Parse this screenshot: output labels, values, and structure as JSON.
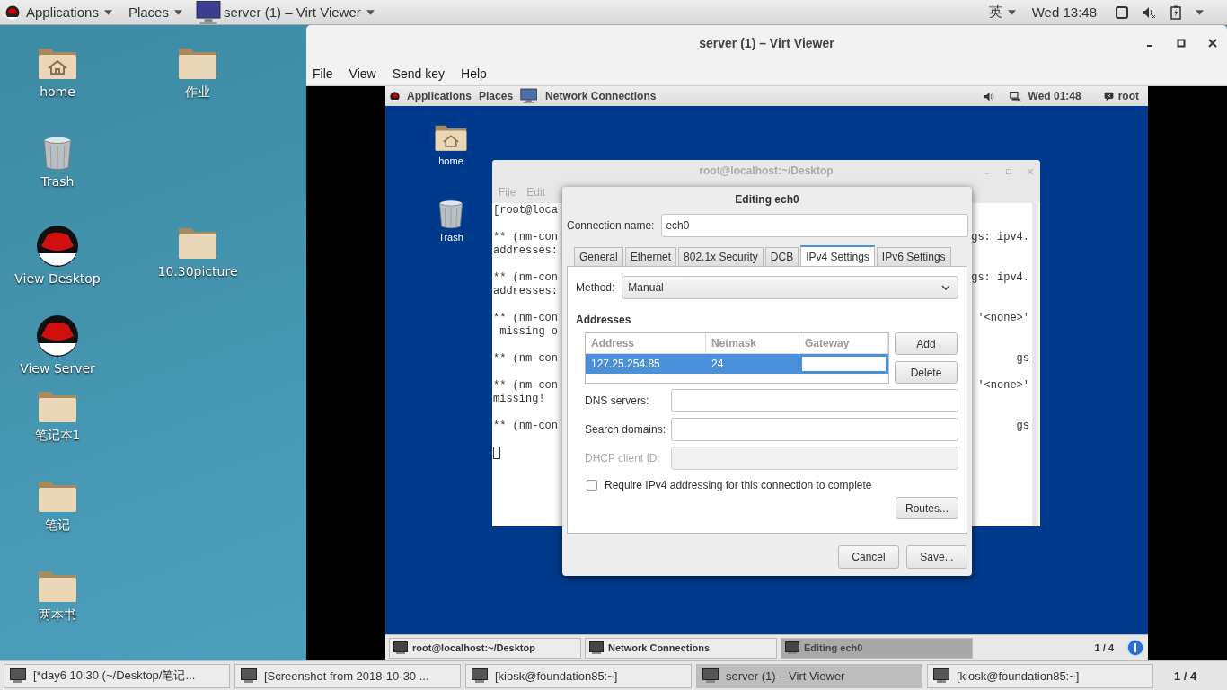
{
  "top_bar": {
    "menus": [
      "Applications",
      "Places"
    ],
    "window_menu": "server (1) – Virt Viewer",
    "input_method": "英",
    "clock": "Wed 13:48"
  },
  "desktop_icons": [
    {
      "kind": "home",
      "label": "home"
    },
    {
      "kind": "folder",
      "label": "作业"
    },
    {
      "kind": "trash",
      "label": "Trash"
    },
    {
      "kind": "hat",
      "label": "View Desktop"
    },
    {
      "kind": "folder",
      "label": "10.30picture"
    },
    {
      "kind": "hat",
      "label": "View Server"
    },
    {
      "kind": "folder",
      "label": "笔记本1"
    },
    {
      "kind": "folder",
      "label": "笔记"
    },
    {
      "kind": "folder",
      "label": "两本书"
    }
  ],
  "viewer_window": {
    "title": "server (1) – Virt Viewer",
    "menu": [
      "File",
      "View",
      "Send key",
      "Help"
    ],
    "guest": {
      "top_bar": {
        "menus": [
          "Applications",
          "Places"
        ],
        "window_menu": "Network Connections",
        "clock": "Wed 01:48",
        "user": "root"
      },
      "desktop_icons": [
        {
          "kind": "home",
          "label": "home"
        },
        {
          "kind": "trash",
          "label": "Trash"
        }
      ],
      "terminal": {
        "title": "root@localhost:~/Desktop",
        "menu": [
          "File",
          "Edit"
        ],
        "blocks": [
          [
            {
              "left": "[root@loca"
            }
          ],
          [
            {
              "left": "** (nm-con",
              "right": "gs: ipv4."
            },
            {
              "left": "addresses:"
            }
          ],
          [
            {
              "left": "** (nm-con",
              "right": "gs: ipv4."
            },
            {
              "left": "addresses:"
            }
          ],
          [
            {
              "left": "** (nm-con",
              "right": "'<none>'"
            },
            {
              "left": " missing o"
            }
          ],
          [
            {
              "left": "** (nm-con",
              "right": "gs"
            }
          ],
          [
            {
              "left": "** (nm-con",
              "right": "'<none>'"
            },
            {
              "left": "missing!"
            }
          ],
          [
            {
              "left": "** (nm-con",
              "right": "gs"
            }
          ]
        ]
      },
      "dialog": {
        "title": "Editing ech0",
        "connection_label": "Connection name:",
        "connection_name": "ech0",
        "tabs": [
          {
            "label": "General",
            "selected": false
          },
          {
            "label": "Ethernet",
            "selected": false
          },
          {
            "label": "802.1x Security",
            "selected": false
          },
          {
            "label": "DCB",
            "selected": false
          },
          {
            "label": "IPv4 Settings",
            "selected": true
          },
          {
            "label": "IPv6 Settings",
            "selected": false
          }
        ],
        "method_label": "Method:",
        "method": "Manual",
        "addresses_heading": "Addresses",
        "table": {
          "columns": [
            "Address",
            "Netmask",
            "Gateway"
          ],
          "rows": [
            {
              "address": "127.25.254.85",
              "netmask": "24",
              "selected": true
            }
          ]
        },
        "table_buttons": [
          "Add",
          "Delete"
        ],
        "fields": [
          {
            "label": "DNS servers:",
            "disabled": false
          },
          {
            "label": "Search domains:",
            "disabled": false
          },
          {
            "label": "DHCP client ID:",
            "disabled": true
          }
        ],
        "require_checkbox": {
          "label": "Require IPv4 addressing for this connection to complete",
          "checked": false
        },
        "routes_button": "Routes...",
        "buttons": [
          "Cancel",
          "Save..."
        ]
      },
      "taskbar": {
        "items": [
          {
            "label": "root@localhost:~/Desktop",
            "selected": false
          },
          {
            "label": "Network Connections",
            "selected": false
          },
          {
            "label": "Editing ech0",
            "selected": true
          }
        ],
        "workspace": "1 / 4"
      }
    }
  },
  "taskbar": {
    "items": [
      {
        "label": "[*day6 10.30 (~/Desktop/笔记...",
        "selected": false
      },
      {
        "label": "[Screenshot from 2018-10-30 ...",
        "selected": false
      },
      {
        "label": "[kiosk@foundation85:~]",
        "selected": false
      },
      {
        "label": "server (1) – Virt Viewer",
        "selected": true
      },
      {
        "label": "[kiosk@foundation85:~]",
        "selected": false
      }
    ],
    "workspace": "1 / 4"
  }
}
